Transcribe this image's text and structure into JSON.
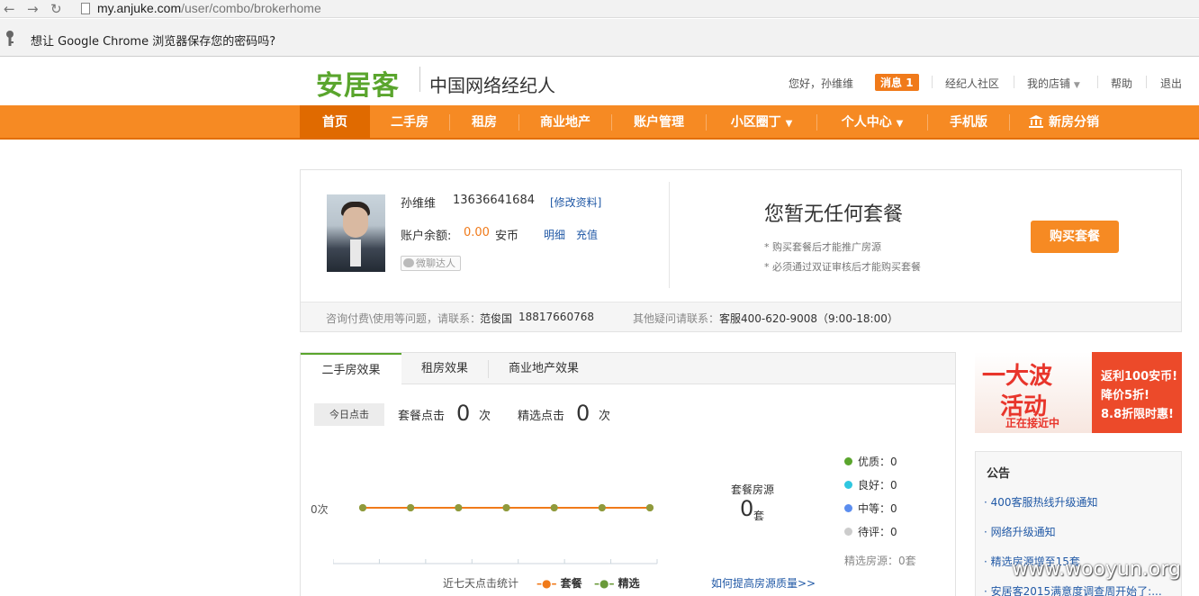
{
  "browser": {
    "url_host": "my.anjuke.com",
    "url_path": "/user/combo/brokerhome",
    "password_prompt": "想让 Google Chrome 浏览器保存您的密码吗?"
  },
  "header": {
    "logo": "安居客",
    "subtitle": "中国网络经纪人",
    "greeting": "您好，孙维维",
    "messages_label": "消息",
    "messages_count": "1",
    "community": "经纪人社区",
    "my_shop": "我的店铺",
    "help": "帮助",
    "logout": "退出"
  },
  "nav": [
    "首页",
    "二手房",
    "租房",
    "商业地产",
    "账户管理",
    "小区圈丁",
    "个人中心",
    "手机版",
    "新房分销"
  ],
  "profile": {
    "name": "孙维维",
    "phone": "13636641684",
    "edit_link": "[修改资料]",
    "balance_label": "账户余额:",
    "balance_value": "0.00",
    "balance_unit": "安币",
    "detail_link": "明细",
    "recharge_link": "充值",
    "wechat_badge": "微聊达人"
  },
  "package": {
    "title": "您暂无任何套餐",
    "note1": "* 购买套餐后才能推广房源",
    "note2": "* 必须通过双证审核后才能购买套餐",
    "buy_button": "购买套餐"
  },
  "footer": {
    "consult_label": "咨询付费\\使用等问题，请联系：",
    "consult_name": "范俊国",
    "consult_phone": "18817660768",
    "other_label": "其他疑问请联系：",
    "other_contact": "客服400-620-9008（9:00-18:00）"
  },
  "tabs": [
    "二手房效果",
    "租房效果",
    "商业地产效果"
  ],
  "stats": {
    "today_button": "今日点击",
    "pkg_click_label": "套餐点击",
    "pkg_click_value": "0",
    "pkg_click_unit": "次",
    "sel_click_label": "精选点击",
    "sel_click_value": "0",
    "sel_click_unit": "次"
  },
  "chart_data": {
    "type": "line",
    "title": "近七天点击统计",
    "categories": [
      "",
      "",
      "",
      "",
      "",
      "",
      ""
    ],
    "series": [
      {
        "name": "套餐",
        "values": [
          0,
          0,
          0,
          0,
          0,
          0,
          0
        ],
        "color": "#f07a1a"
      },
      {
        "name": "精选",
        "values": [
          0,
          0,
          0,
          0,
          0,
          0,
          0
        ],
        "color": "#6a9a3a"
      }
    ],
    "ytick": "0次",
    "ylim": [
      0,
      1
    ],
    "grid": false,
    "legend": "bottom"
  },
  "quality": {
    "label": "套餐房源",
    "value": "0",
    "unit": "套",
    "items": [
      {
        "label": "优质：0",
        "color": "#5aa52d"
      },
      {
        "label": "良好：0",
        "color": "#2fc7e0"
      },
      {
        "label": "中等：0",
        "color": "#5b8def"
      },
      {
        "label": "待评：0",
        "color": "#cccccc"
      }
    ],
    "selected": "精选房源：0套",
    "improve_link": "如何提高房源质量>>"
  },
  "ad": {
    "line1": "一大波",
    "line2": "活动",
    "line3": "正在接近中",
    "r1": "返利100安币!",
    "r2": "降价5折!",
    "r3": "8.8折限时惠!"
  },
  "notice": {
    "title": "公告",
    "items": [
      "400客服热线升级通知",
      "网络升级通知",
      "精选房源增至15套",
      "安居客2015满意度调查周开始了:..."
    ]
  },
  "watermark": "www.wooyun.org",
  "colors": {
    "brand_green": "#5aa52d",
    "nav_orange": "#f68a23",
    "link_blue": "#2159a6"
  }
}
